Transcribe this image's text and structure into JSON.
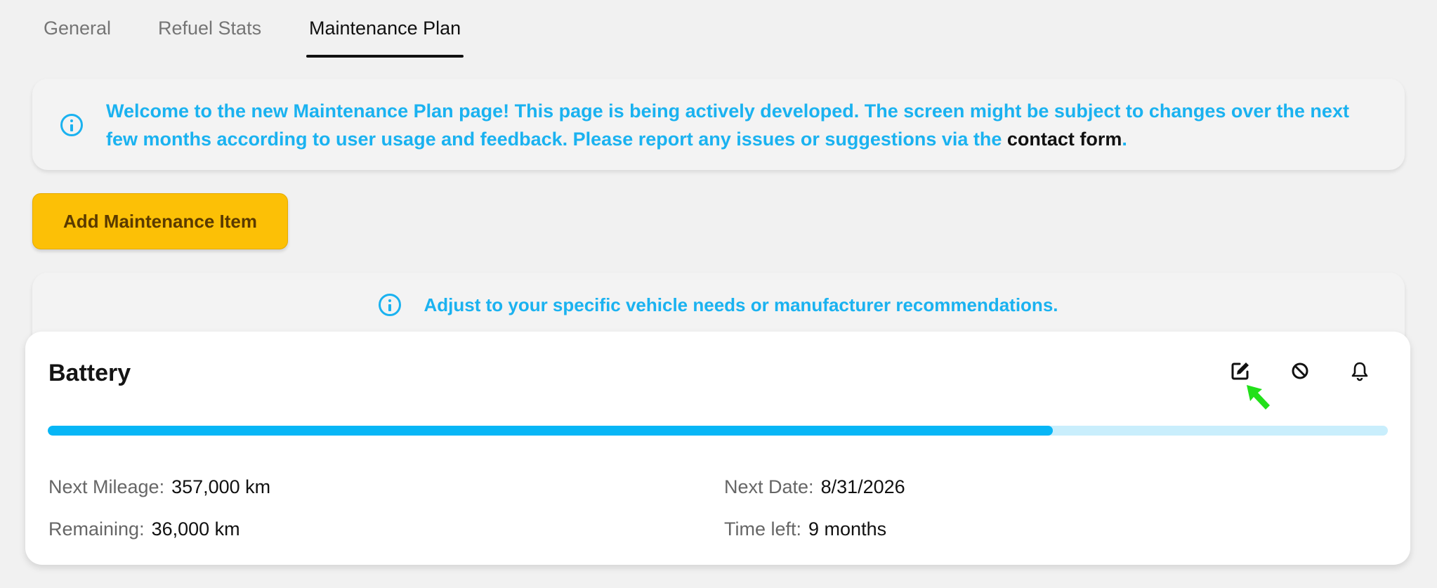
{
  "tabs": [
    {
      "label": "General",
      "active": false
    },
    {
      "label": "Refuel Stats",
      "active": false
    },
    {
      "label": "Maintenance Plan",
      "active": true
    }
  ],
  "banner": {
    "text": "Welcome to the new Maintenance Plan page! This page is being actively developed. The screen might be subject to changes over the next few months according to user usage and feedback. Please report any issues or suggestions via the ",
    "link_label": "contact form",
    "suffix": ".",
    "icon": "info-icon"
  },
  "add_button": {
    "label": "Add Maintenance Item"
  },
  "hint": {
    "text": "Adjust to your specific vehicle needs or manufacturer recommendations.",
    "icon": "info-icon"
  },
  "item": {
    "title": "Battery",
    "actions": [
      {
        "name": "edit",
        "icon": "edit-icon"
      },
      {
        "name": "disable",
        "icon": "block-icon"
      },
      {
        "name": "reminder",
        "icon": "bell-icon"
      }
    ],
    "progress_percent": 75,
    "fields": {
      "next_mileage": {
        "label": "Next Mileage:",
        "value": "357,000 km"
      },
      "remaining": {
        "label": "Remaining:",
        "value": "36,000 km"
      },
      "next_date": {
        "label": "Next Date:",
        "value": "8/31/2026"
      },
      "time_left": {
        "label": "Time left:",
        "value": "9 months"
      }
    }
  },
  "colors": {
    "accent": "#1ab2f0",
    "progress_fill": "#07b6f6",
    "progress_track": "#c9eefc",
    "button": "#fcc006",
    "cursor": "#22e01a"
  }
}
